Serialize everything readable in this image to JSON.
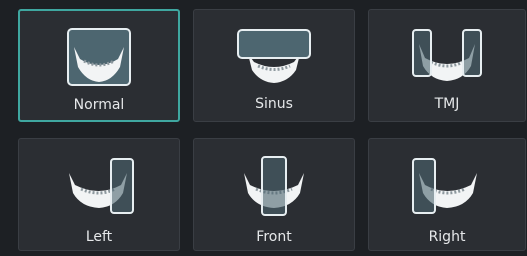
{
  "modes": [
    {
      "label": "Normal",
      "icon": "normal-fov-icon",
      "selected": true
    },
    {
      "label": "Sinus",
      "icon": "sinus-fov-icon",
      "selected": false
    },
    {
      "label": "TMJ",
      "icon": "tmj-fov-icon",
      "selected": false
    },
    {
      "label": "Left",
      "icon": "left-fov-icon",
      "selected": false
    },
    {
      "label": "Front",
      "icon": "front-fov-icon",
      "selected": false
    },
    {
      "label": "Right",
      "icon": "right-fov-icon",
      "selected": false
    }
  ],
  "colors": {
    "accent": "#3fa7a0",
    "tile_bg": "#2b2e33",
    "page_bg": "#1d2024"
  }
}
